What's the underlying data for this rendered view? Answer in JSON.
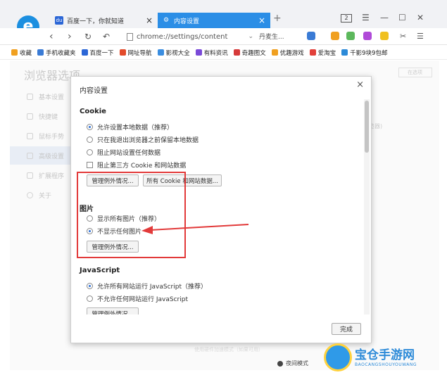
{
  "tabs": [
    {
      "label": "百度一下，你就知道",
      "active": false
    },
    {
      "label": "内容设置",
      "active": true
    }
  ],
  "window": {
    "tab_count": "2"
  },
  "address": {
    "url": "chrome://settings/content",
    "search_text": "丹麦生..."
  },
  "bookmarks": [
    {
      "label": "收藏",
      "color": "#f0a020"
    },
    {
      "label": "手机收藏夹",
      "color": "#3a7bd5"
    },
    {
      "label": "百度一下",
      "color": "#2b66d6"
    },
    {
      "label": "网址导航",
      "color": "#e24a2a"
    },
    {
      "label": "影视大全",
      "color": "#3a8de0"
    },
    {
      "label": "有料资讯",
      "color": "#7a4ad8"
    },
    {
      "label": "奇趣图文",
      "color": "#d63a3a"
    },
    {
      "label": "优趣游戏",
      "color": "#f0a020"
    },
    {
      "label": "爱淘宝",
      "color": "#e2403a"
    },
    {
      "label": "千影9块9包邮",
      "color": "#2c8ad8"
    }
  ],
  "settings": {
    "title": "浏览器选项",
    "search_placeholder": "在选项",
    "sidebar": [
      {
        "label": "基本设置"
      },
      {
        "label": "快捷键"
      },
      {
        "label": "鼠标手势"
      },
      {
        "label": "高级设置",
        "active": true
      },
      {
        "label": "扩展程序"
      },
      {
        "label": "关于"
      }
    ],
    "right_hint": "览器)",
    "bottom_text": "使用硬件加速模式（如果可用）",
    "night_mode": "夜间模式"
  },
  "modal": {
    "title": "内容设置",
    "close": "×",
    "done": "完成",
    "cookie": {
      "title": "Cookie",
      "options": [
        {
          "label": "允许设置本地数据（推荐）",
          "checked": true
        },
        {
          "label": "只在我退出浏览器之前保留本地数据",
          "checked": false
        },
        {
          "label": "阻止网站设置任何数据",
          "checked": false
        }
      ],
      "checkbox": "阻止第三方 Cookie 和网站数据",
      "btn_exceptions": "管理例外情况...",
      "btn_all": "所有 Cookie 和网站数据..."
    },
    "images": {
      "title": "图片",
      "options": [
        {
          "label": "显示所有图片（推荐）",
          "checked": false
        },
        {
          "label": "不显示任何图片",
          "checked": true
        }
      ],
      "btn_exceptions": "管理例外情况..."
    },
    "javascript": {
      "title": "JavaScript",
      "options": [
        {
          "label": "允许所有网站运行 JavaScript（推荐）",
          "checked": true
        },
        {
          "label": "不允许任何网站运行 JavaScript",
          "checked": false
        }
      ],
      "btn_exceptions": "管理例外情况..."
    }
  },
  "watermark": {
    "name": "宝仓手游网",
    "sub": "BAOCANGSHOUYOUWANG"
  },
  "colors": {
    "accent": "#2b8ee6",
    "highlight": "#e23a3a"
  }
}
